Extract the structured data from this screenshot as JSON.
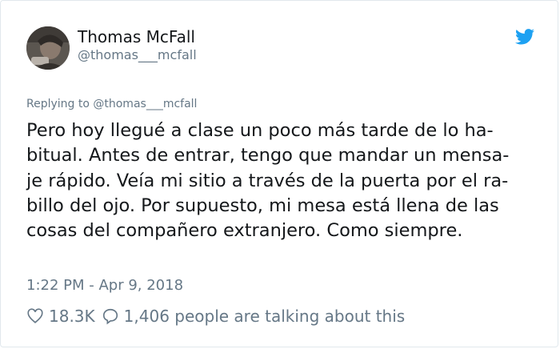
{
  "author": {
    "display_name": "Thomas McFall",
    "handle": "@thomas___mcfall",
    "avatar_icon": "profile-photo"
  },
  "reply_context": "Replying to @thomas___mcfall",
  "tweet": {
    "lines": [
      "Pero hoy llegué a clase un poco más tarde de lo ha-",
      "bitual. Antes de entrar, tengo que mandar un mensa-",
      "je rápido. Veía mi sitio a través de la puerta por el ra-",
      "billo del ojo. Por supuesto, mi mesa está llena de las",
      "cosas del compañero extranjero. Como siempre."
    ]
  },
  "timestamp": "1:22 PM - Apr 9, 2018",
  "stats": {
    "likes": "18.3K",
    "talking": "1,406 people are talking about this"
  },
  "icons": {
    "brand": "twitter-bird-icon",
    "like": "heart-icon",
    "reply": "speech-bubble-icon"
  },
  "colors": {
    "brand_blue": "#1da1f2",
    "secondary_text": "#657786",
    "primary_text": "#14171a"
  }
}
